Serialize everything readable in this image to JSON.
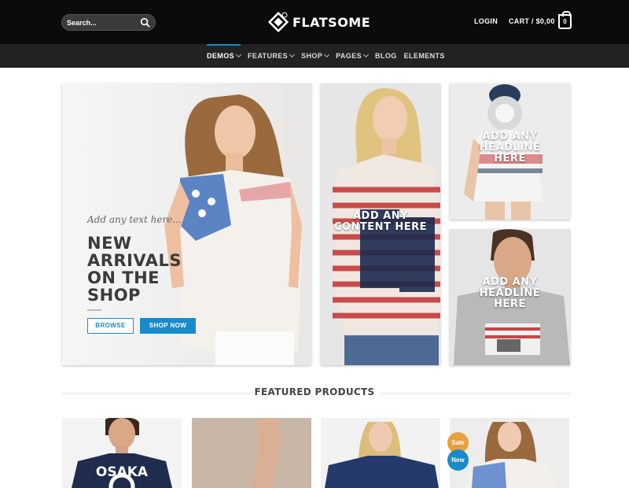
{
  "header": {
    "search_placeholder": "Search...",
    "logo_text": "FLATSOME",
    "login": "LOGIN",
    "cart": "CART / $0,00",
    "cart_count": "0"
  },
  "nav": {
    "items": [
      {
        "label": "DEMOS",
        "dropdown": true,
        "active": true
      },
      {
        "label": "FEATURES",
        "dropdown": true
      },
      {
        "label": "SHOP",
        "dropdown": true
      },
      {
        "label": "PAGES",
        "dropdown": true
      },
      {
        "label": "BLOG",
        "dropdown": false
      },
      {
        "label": "ELEMENTS",
        "dropdown": false
      }
    ]
  },
  "hero": {
    "tagline": "Add any text here...",
    "headline": [
      "NEW",
      "ARRIVALS",
      "ON THE",
      "SHOP"
    ],
    "browse_label": "BROWSE",
    "shop_now_label": "SHOP NOW"
  },
  "banners": {
    "middle": [
      "ADD ANY",
      "CONTENT HERE"
    ],
    "top_right": [
      "ADD ANY",
      "HEADLINE",
      "HERE"
    ],
    "bottom_right": [
      "ADD ANY",
      "HEADLINE",
      "HERE"
    ]
  },
  "featured": {
    "title": "FEATURED PRODUCTS",
    "products": [
      {
        "shirt_text": "OSAKA"
      },
      {},
      {},
      {
        "badges": [
          "Sale",
          "New"
        ]
      }
    ]
  },
  "colors": {
    "accent": "#1a8bc9",
    "sale": "#e7a13b",
    "header_bg": "#0b0b0b",
    "nav_bg": "#222222"
  }
}
